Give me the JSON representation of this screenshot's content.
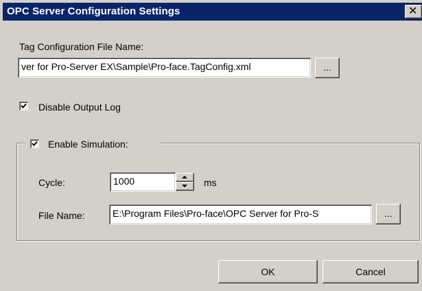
{
  "window": {
    "title": "OPC Server Configuration Settings",
    "close_glyph": "✕"
  },
  "tag_config": {
    "label": "Tag Configuration File Name:",
    "value": "ver for Pro-Server EX\\Sample\\Pro-face.TagConfig.xml",
    "browse_label": "..."
  },
  "disable_output_log": {
    "label": "Disable Output Log",
    "checked": true
  },
  "simulation": {
    "label": "Enable Simulation:",
    "checked": true,
    "cycle_label": "Cycle:",
    "cycle_value": "1000",
    "cycle_unit": "ms",
    "file_label": "File Name:",
    "file_value": "E:\\Program Files\\Pro-face\\OPC Server for Pro-S",
    "browse_label": "..."
  },
  "buttons": {
    "ok": "OK",
    "cancel": "Cancel"
  },
  "icons": {
    "close": "close-icon",
    "check": "checkmark-icon",
    "spin_up": "arrow-up-icon",
    "spin_down": "arrow-down-icon"
  }
}
